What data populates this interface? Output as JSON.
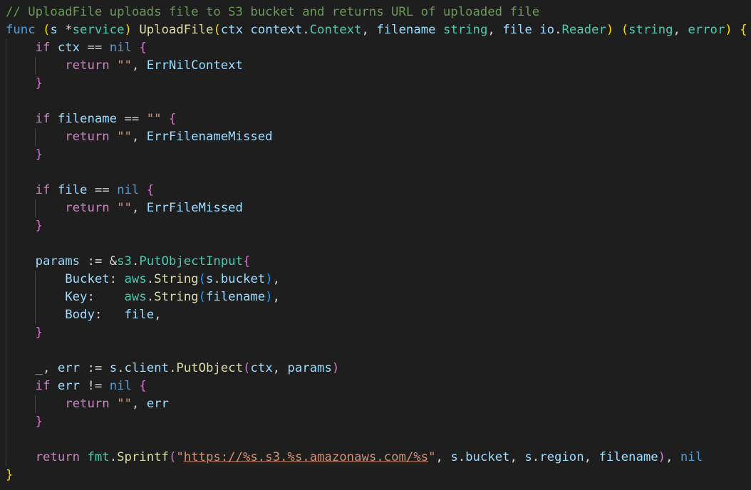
{
  "editor": {
    "lines": [
      [
        {
          "t": "// UploadFile uploads file to S3 bucket and returns URL of uploaded file",
          "c": "cm"
        }
      ],
      [
        {
          "t": "func",
          "c": "kw"
        },
        {
          "t": " ",
          "c": "pl"
        },
        {
          "t": "(",
          "c": "b1"
        },
        {
          "t": "s",
          "c": "vr"
        },
        {
          "t": " *",
          "c": "pl"
        },
        {
          "t": "service",
          "c": "ty"
        },
        {
          "t": ")",
          "c": "b1"
        },
        {
          "t": " ",
          "c": "pl"
        },
        {
          "t": "UploadFile",
          "c": "fn"
        },
        {
          "t": "(",
          "c": "b1"
        },
        {
          "t": "ctx",
          "c": "vr"
        },
        {
          "t": " ",
          "c": "pl"
        },
        {
          "t": "context",
          "c": "vr"
        },
        {
          "t": ".",
          "c": "pl"
        },
        {
          "t": "Context",
          "c": "ty"
        },
        {
          "t": ", ",
          "c": "pl"
        },
        {
          "t": "filename",
          "c": "vr"
        },
        {
          "t": " ",
          "c": "pl"
        },
        {
          "t": "string",
          "c": "ty"
        },
        {
          "t": ", ",
          "c": "pl"
        },
        {
          "t": "file",
          "c": "vr"
        },
        {
          "t": " ",
          "c": "pl"
        },
        {
          "t": "io",
          "c": "vr"
        },
        {
          "t": ".",
          "c": "pl"
        },
        {
          "t": "Reader",
          "c": "ty"
        },
        {
          "t": ")",
          "c": "b1"
        },
        {
          "t": " ",
          "c": "pl"
        },
        {
          "t": "(",
          "c": "b1"
        },
        {
          "t": "string",
          "c": "ty"
        },
        {
          "t": ", ",
          "c": "pl"
        },
        {
          "t": "error",
          "c": "ty"
        },
        {
          "t": ")",
          "c": "b1"
        },
        {
          "t": " ",
          "c": "pl"
        },
        {
          "t": "{",
          "c": "b1"
        }
      ],
      [
        {
          "t": "    ",
          "c": "pl"
        },
        {
          "t": "if",
          "c": "kc"
        },
        {
          "t": " ",
          "c": "pl"
        },
        {
          "t": "ctx",
          "c": "vr"
        },
        {
          "t": " == ",
          "c": "pl"
        },
        {
          "t": "nil",
          "c": "kw"
        },
        {
          "t": " ",
          "c": "pl"
        },
        {
          "t": "{",
          "c": "b2"
        }
      ],
      [
        {
          "t": "        ",
          "c": "pl"
        },
        {
          "t": "return",
          "c": "kc"
        },
        {
          "t": " ",
          "c": "pl"
        },
        {
          "t": "\"\"",
          "c": "st"
        },
        {
          "t": ", ",
          "c": "pl"
        },
        {
          "t": "ErrNilContext",
          "c": "vr"
        }
      ],
      [
        {
          "t": "    ",
          "c": "pl"
        },
        {
          "t": "}",
          "c": "b2"
        }
      ],
      [],
      [
        {
          "t": "    ",
          "c": "pl"
        },
        {
          "t": "if",
          "c": "kc"
        },
        {
          "t": " ",
          "c": "pl"
        },
        {
          "t": "filename",
          "c": "vr"
        },
        {
          "t": " == ",
          "c": "pl"
        },
        {
          "t": "\"\"",
          "c": "st"
        },
        {
          "t": " ",
          "c": "pl"
        },
        {
          "t": "{",
          "c": "b2"
        }
      ],
      [
        {
          "t": "        ",
          "c": "pl"
        },
        {
          "t": "return",
          "c": "kc"
        },
        {
          "t": " ",
          "c": "pl"
        },
        {
          "t": "\"\"",
          "c": "st"
        },
        {
          "t": ", ",
          "c": "pl"
        },
        {
          "t": "ErrFilenameMissed",
          "c": "vr"
        }
      ],
      [
        {
          "t": "    ",
          "c": "pl"
        },
        {
          "t": "}",
          "c": "b2"
        }
      ],
      [],
      [
        {
          "t": "    ",
          "c": "pl"
        },
        {
          "t": "if",
          "c": "kc"
        },
        {
          "t": " ",
          "c": "pl"
        },
        {
          "t": "file",
          "c": "vr"
        },
        {
          "t": " == ",
          "c": "pl"
        },
        {
          "t": "nil",
          "c": "kw"
        },
        {
          "t": " ",
          "c": "pl"
        },
        {
          "t": "{",
          "c": "b2"
        }
      ],
      [
        {
          "t": "        ",
          "c": "pl"
        },
        {
          "t": "return",
          "c": "kc"
        },
        {
          "t": " ",
          "c": "pl"
        },
        {
          "t": "\"\"",
          "c": "st"
        },
        {
          "t": ", ",
          "c": "pl"
        },
        {
          "t": "ErrFileMissed",
          "c": "vr"
        }
      ],
      [
        {
          "t": "    ",
          "c": "pl"
        },
        {
          "t": "}",
          "c": "b2"
        }
      ],
      [],
      [
        {
          "t": "    ",
          "c": "pl"
        },
        {
          "t": "params",
          "c": "vr"
        },
        {
          "t": " := &",
          "c": "pl"
        },
        {
          "t": "s3",
          "c": "ty"
        },
        {
          "t": ".",
          "c": "pl"
        },
        {
          "t": "PutObjectInput",
          "c": "ty"
        },
        {
          "t": "{",
          "c": "b2"
        }
      ],
      [
        {
          "t": "        ",
          "c": "pl"
        },
        {
          "t": "Bucket",
          "c": "vr"
        },
        {
          "t": ": ",
          "c": "pl"
        },
        {
          "t": "aws",
          "c": "ty"
        },
        {
          "t": ".",
          "c": "pl"
        },
        {
          "t": "String",
          "c": "fn"
        },
        {
          "t": "(",
          "c": "b3"
        },
        {
          "t": "s",
          "c": "vr"
        },
        {
          "t": ".",
          "c": "pl"
        },
        {
          "t": "bucket",
          "c": "vr"
        },
        {
          "t": ")",
          "c": "b3"
        },
        {
          "t": ",",
          "c": "pl"
        }
      ],
      [
        {
          "t": "        ",
          "c": "pl"
        },
        {
          "t": "Key",
          "c": "vr"
        },
        {
          "t": ":    ",
          "c": "pl"
        },
        {
          "t": "aws",
          "c": "ty"
        },
        {
          "t": ".",
          "c": "pl"
        },
        {
          "t": "String",
          "c": "fn"
        },
        {
          "t": "(",
          "c": "b3"
        },
        {
          "t": "filename",
          "c": "vr"
        },
        {
          "t": ")",
          "c": "b3"
        },
        {
          "t": ",",
          "c": "pl"
        }
      ],
      [
        {
          "t": "        ",
          "c": "pl"
        },
        {
          "t": "Body",
          "c": "vr"
        },
        {
          "t": ":   ",
          "c": "pl"
        },
        {
          "t": "file",
          "c": "vr"
        },
        {
          "t": ",",
          "c": "pl"
        }
      ],
      [
        {
          "t": "    ",
          "c": "pl"
        },
        {
          "t": "}",
          "c": "b2"
        }
      ],
      [],
      [
        {
          "t": "    ",
          "c": "pl"
        },
        {
          "t": "_",
          "c": "vr"
        },
        {
          "t": ", ",
          "c": "pl"
        },
        {
          "t": "err",
          "c": "vr"
        },
        {
          "t": " := ",
          "c": "pl"
        },
        {
          "t": "s",
          "c": "vr"
        },
        {
          "t": ".",
          "c": "pl"
        },
        {
          "t": "client",
          "c": "vr"
        },
        {
          "t": ".",
          "c": "pl"
        },
        {
          "t": "PutObject",
          "c": "fn"
        },
        {
          "t": "(",
          "c": "b2"
        },
        {
          "t": "ctx",
          "c": "vr"
        },
        {
          "t": ", ",
          "c": "pl"
        },
        {
          "t": "params",
          "c": "vr"
        },
        {
          "t": ")",
          "c": "b2"
        }
      ],
      [
        {
          "t": "    ",
          "c": "pl"
        },
        {
          "t": "if",
          "c": "kc"
        },
        {
          "t": " ",
          "c": "pl"
        },
        {
          "t": "err",
          "c": "vr"
        },
        {
          "t": " != ",
          "c": "pl"
        },
        {
          "t": "nil",
          "c": "kw"
        },
        {
          "t": " ",
          "c": "pl"
        },
        {
          "t": "{",
          "c": "b2"
        }
      ],
      [
        {
          "t": "        ",
          "c": "pl"
        },
        {
          "t": "return",
          "c": "kc"
        },
        {
          "t": " ",
          "c": "pl"
        },
        {
          "t": "\"\"",
          "c": "st"
        },
        {
          "t": ", ",
          "c": "pl"
        },
        {
          "t": "err",
          "c": "vr"
        }
      ],
      [
        {
          "t": "    ",
          "c": "pl"
        },
        {
          "t": "}",
          "c": "b2"
        }
      ],
      [],
      [
        {
          "t": "    ",
          "c": "pl"
        },
        {
          "t": "return",
          "c": "kc"
        },
        {
          "t": " ",
          "c": "pl"
        },
        {
          "t": "fmt",
          "c": "ty"
        },
        {
          "t": ".",
          "c": "pl"
        },
        {
          "t": "Sprintf",
          "c": "fn"
        },
        {
          "t": "(",
          "c": "b2"
        },
        {
          "t": "\"",
          "c": "st"
        },
        {
          "t": "https://%s.s3.%s.amazonaws.com/%s",
          "c": "url"
        },
        {
          "t": "\"",
          "c": "st"
        },
        {
          "t": ", ",
          "c": "pl"
        },
        {
          "t": "s",
          "c": "vr"
        },
        {
          "t": ".",
          "c": "pl"
        },
        {
          "t": "bucket",
          "c": "vr"
        },
        {
          "t": ", ",
          "c": "pl"
        },
        {
          "t": "s",
          "c": "vr"
        },
        {
          "t": ".",
          "c": "pl"
        },
        {
          "t": "region",
          "c": "vr"
        },
        {
          "t": ", ",
          "c": "pl"
        },
        {
          "t": "filename",
          "c": "vr"
        },
        {
          "t": ")",
          "c": "b2"
        },
        {
          "t": ", ",
          "c": "pl"
        },
        {
          "t": "nil",
          "c": "kw"
        }
      ],
      [
        {
          "t": "}",
          "c": "b1"
        }
      ]
    ]
  }
}
